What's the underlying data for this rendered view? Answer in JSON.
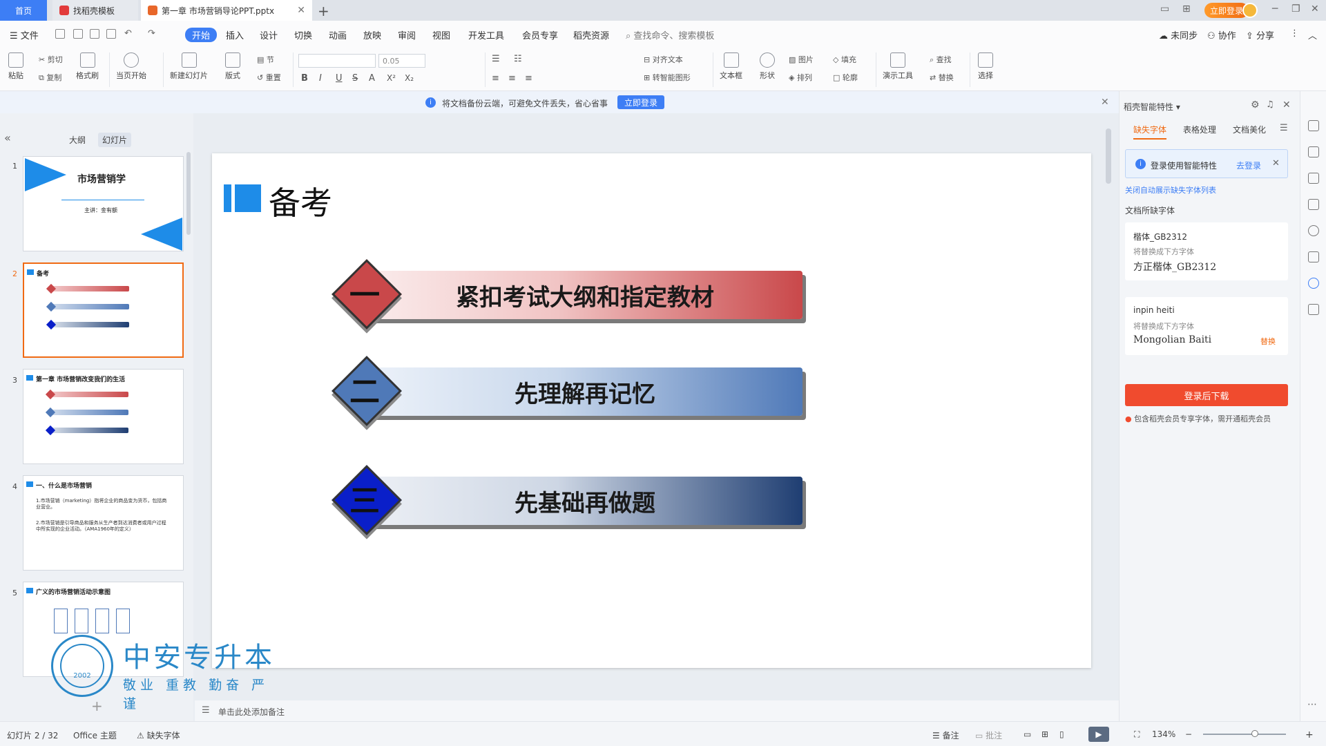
{
  "tabs": {
    "home": "首页",
    "template": "找稻壳模板",
    "document": "第一章 市场营销导论PPT.pptx",
    "login_pill": "立即登录"
  },
  "menu": {
    "file": "文件",
    "items": [
      "开始",
      "插入",
      "设计",
      "切换",
      "动画",
      "放映",
      "审阅",
      "视图",
      "开发工具",
      "会员专享",
      "稻壳资源"
    ],
    "search_placeholder": "查找命令、搜索模板",
    "not_synced": "未同步",
    "collaborate": "协作",
    "share": "分享"
  },
  "ribbon": {
    "paste": "粘贴",
    "cut": "剪切",
    "copy": "复制",
    "format_painter": "格式刷",
    "play_from_current": "当页开始",
    "new_slide": "新建幻灯片",
    "layout": "版式",
    "section": "节",
    "reset": "重置",
    "font_size": "0.05",
    "align_text": "对齐文本",
    "convert_smartart": "转智能图形",
    "text_box": "文本框",
    "shape": "形状",
    "picture": "图片",
    "arrange": "排列",
    "fill": "填充",
    "outline": "轮廓",
    "present_tools": "演示工具",
    "find": "查找",
    "replace": "替换",
    "select": "选择"
  },
  "notice": {
    "text": "将文档备份云端，可避免文件丢失，省心省事",
    "button": "立即登录"
  },
  "left_panel": {
    "tab_outline": "大纲",
    "tab_slides": "幻灯片",
    "thumbs": [
      {
        "num": "1",
        "title": "市场营销学",
        "subtitle": "主讲：金有额"
      },
      {
        "num": "2",
        "title": "备考"
      },
      {
        "num": "3",
        "title": "第一章  市场营销改变我们的生活"
      },
      {
        "num": "4",
        "title": "一、什么是市场营销",
        "lines": [
          "1.市场营销（marketing）指将企业的商品变为货币，包括商业营业。",
          "2.市场营销是引导商品和服务从生产者到达消费者或用户过程中所实现的企业活动。（AMA1960年的定义）"
        ]
      },
      {
        "num": "5",
        "title": "广义的市场营销活动示意图"
      }
    ]
  },
  "slide": {
    "title": "备考",
    "items": [
      {
        "num": "一",
        "text": "紧扣考试大纲和指定教材"
      },
      {
        "num": "二",
        "text": "先理解再记忆"
      },
      {
        "num": "三",
        "text": "先基础再做题"
      }
    ],
    "colors": {
      "red": "#c9484a",
      "blue": "#4f79b8",
      "navy": "#0a1fc9",
      "title_block": "#1e8ce8"
    }
  },
  "notes": {
    "placeholder": "单击此处添加备注"
  },
  "right_panel": {
    "title": "稻壳智能特性",
    "tabs": [
      "缺失字体",
      "表格处理",
      "文档美化"
    ],
    "login_text": "登录使用智能特性",
    "login_link": "去登录",
    "toggle_link": "关闭自动展示缺失字体列表",
    "section_title": "文档所缺字体",
    "fonts": [
      {
        "missing": "楷体_GB2312",
        "replace_label": "将替换成下方字体",
        "replacement": "方正楷体_GB2312"
      },
      {
        "missing": "inpin heiti",
        "replace_label": "将替换成下方字体",
        "replacement": "Mongolian Baiti",
        "action": "替换"
      }
    ],
    "download_button": "登录后下载",
    "member_note": "包含稻壳会员专享字体，需开通稻壳会员"
  },
  "status": {
    "slide_count": "幻灯片 2 / 32",
    "theme": "Office 主题",
    "missing_font": "缺失字体",
    "notes": "备注",
    "comments": "批注",
    "zoom": "134%"
  },
  "watermark": {
    "name": "中安专升本",
    "motto": "敬业 重教 勤奋 严谨",
    "year": "2002"
  }
}
